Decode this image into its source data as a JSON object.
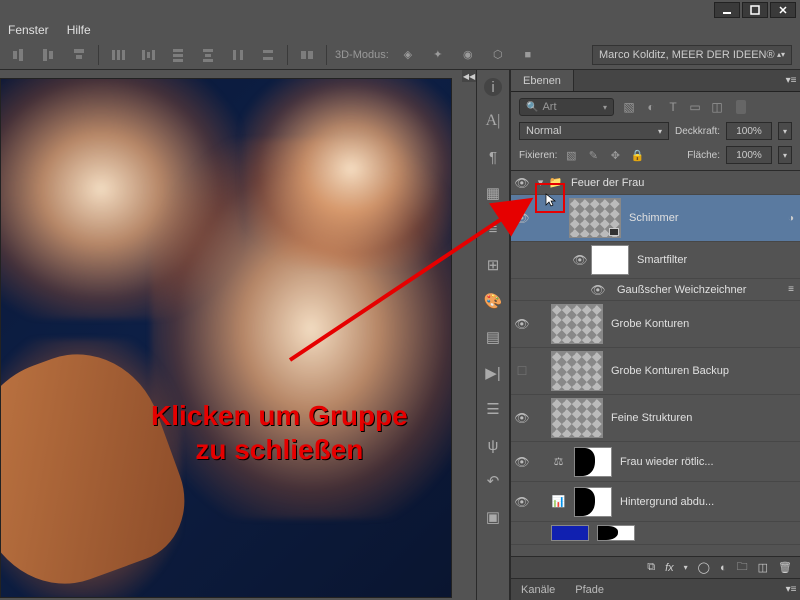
{
  "window": {
    "menu_fenster": "Fenster",
    "menu_hilfe": "Hilfe"
  },
  "toolbar": {
    "mode3d_label": "3D-Modus:",
    "account": "Marco Kolditz, MEER DER IDEEN®"
  },
  "panel": {
    "tab_ebenen": "Ebenen",
    "search_placeholder": "Art",
    "blend_mode": "Normal",
    "deckkraft_label": "Deckkraft:",
    "deckkraft_value": "100%",
    "fixieren_label": "Fixieren:",
    "flaeche_label": "Fläche:",
    "flaeche_value": "100%"
  },
  "layers": {
    "group": "Feuer der Frau",
    "schimmer": "Schimmer",
    "smartfilter": "Smartfilter",
    "gauss": "Gaußscher Weichzeichner",
    "grobe": "Grobe Konturen",
    "grobe_backup": "Grobe Konturen Backup",
    "feine": "Feine Strukturen",
    "frau": "Frau wieder rötlic...",
    "hg": "Hintergrund abdu..."
  },
  "bottom_icons": {
    "fx": "fx"
  },
  "bottom_tabs": {
    "kanaele": "Kanäle",
    "pfade": "Pfade"
  },
  "annotation": {
    "line1": "Klicken um Gruppe",
    "line2": "zu schließen"
  }
}
